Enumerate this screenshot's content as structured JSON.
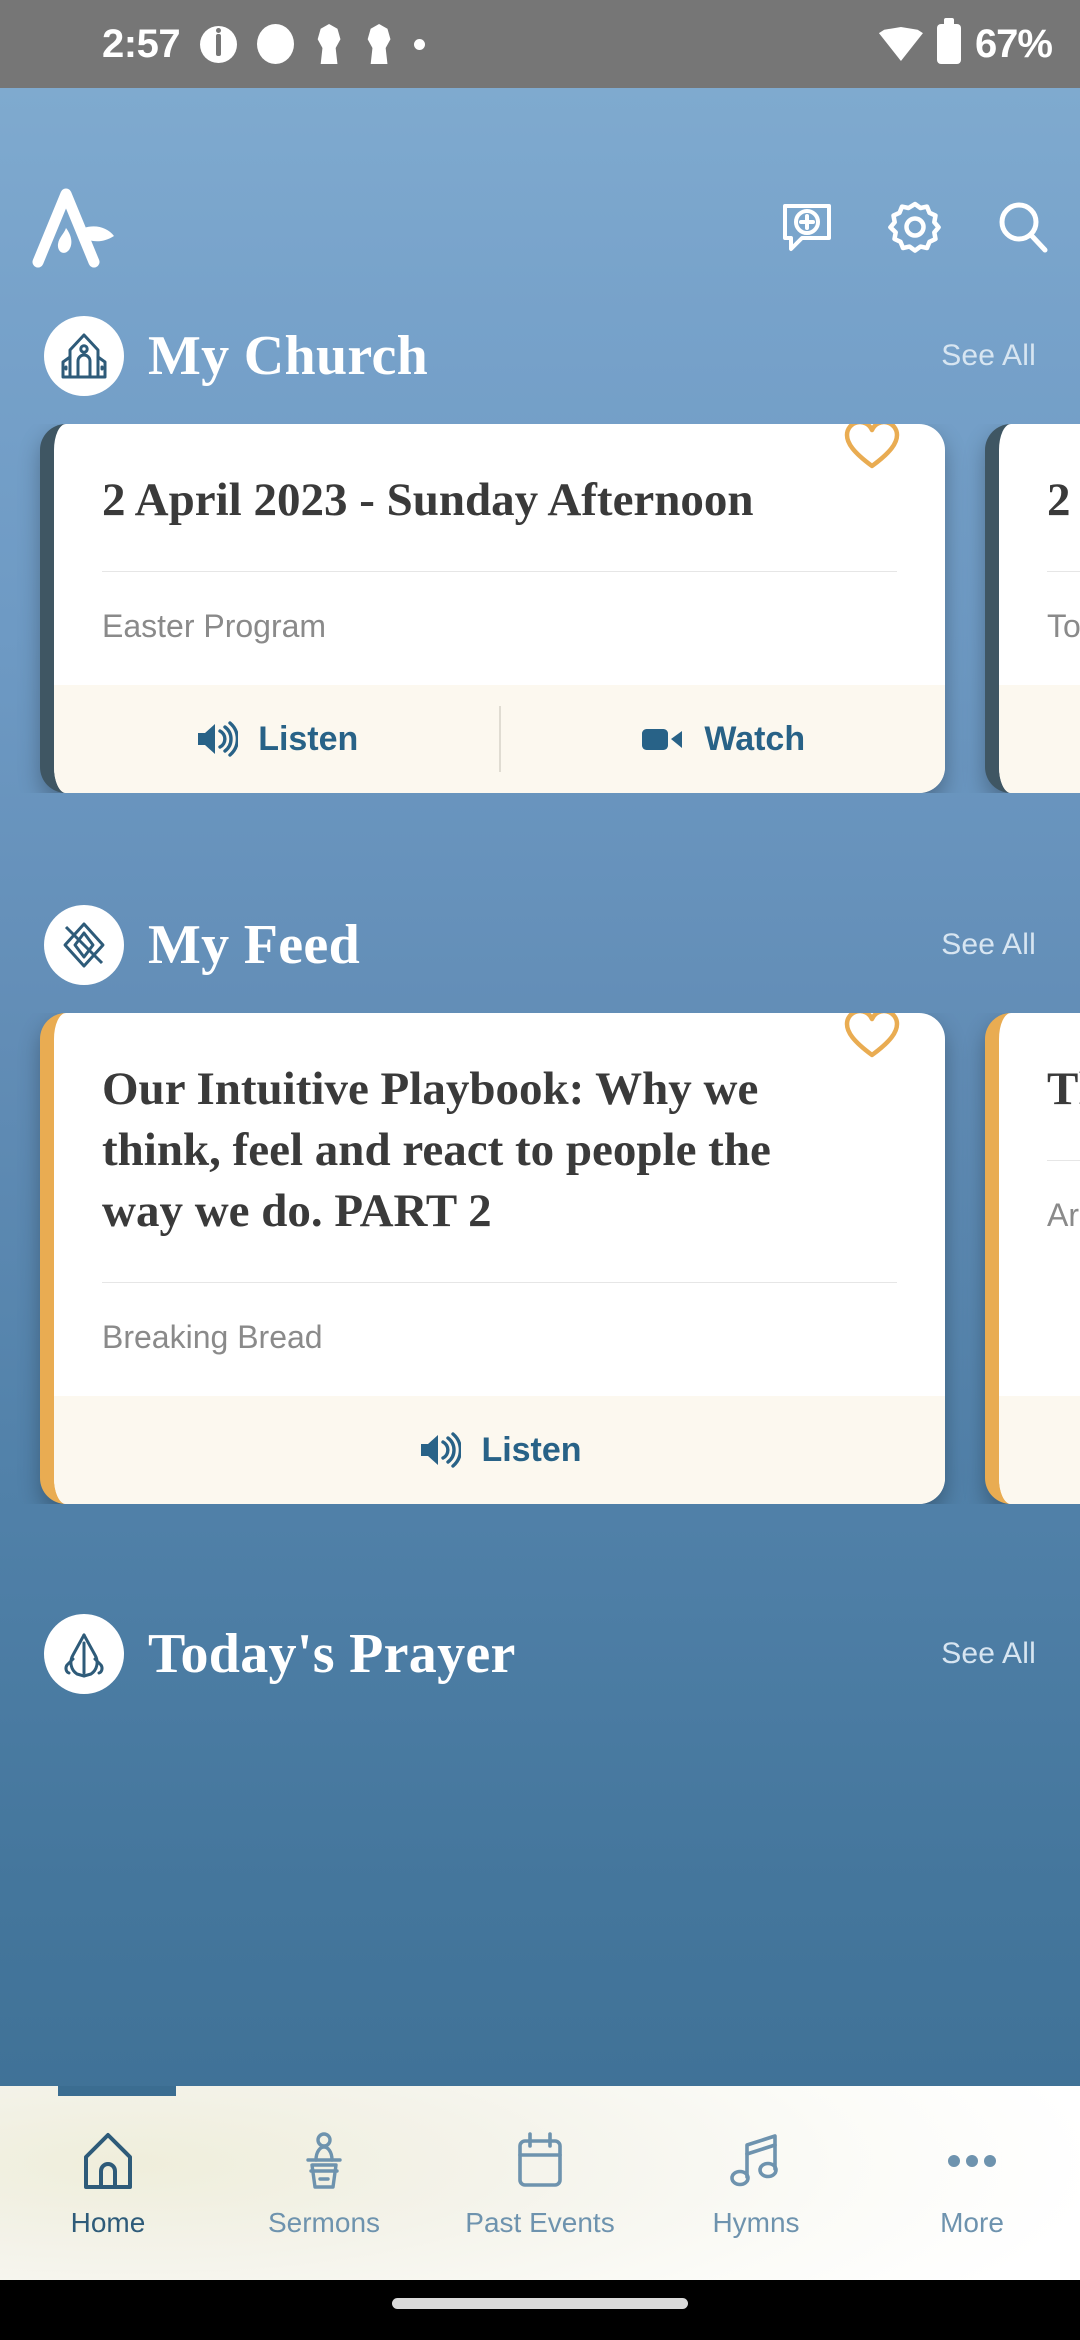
{
  "status_bar": {
    "time": "2:57",
    "battery_percent": "67%",
    "icons": [
      "info-icon",
      "circle-icon",
      "location-pin-icon",
      "location-pin-icon",
      "dot-icon"
    ],
    "right_icons": [
      "wifi-icon",
      "battery-icon"
    ],
    "background_color": "#767676"
  },
  "app_bar": {
    "logo_name": "prayer-flame-logo",
    "actions": [
      {
        "name": "add-chat-icon",
        "label": "Add Chat"
      },
      {
        "name": "gear-icon",
        "label": "Settings"
      },
      {
        "name": "search-icon",
        "label": "Search"
      }
    ],
    "background_color": "#7BA7D1"
  },
  "theme": {
    "bg_top": "#7FAACF",
    "bg_bottom": "#3B6D91",
    "accent_blue": "#286287",
    "accent_gold": "#E9AC52",
    "card_footer": "#FCF8EF"
  },
  "sections": [
    {
      "id": "my-church",
      "title": "My Church",
      "icon": "church-icon",
      "see_all": "See All",
      "cards": [
        {
          "title": "2 April 2023 - Sunday Afternoon",
          "subtitle": "Easter Program",
          "edge_color": "#3F5663",
          "favorite_icon": "heart-icon",
          "actions": [
            {
              "name": "listen-button",
              "label": "Listen",
              "icon": "speaker-icon"
            },
            {
              "name": "watch-button",
              "label": "Watch",
              "icon": "video-camera-icon"
            }
          ]
        },
        {
          "title": "2",
          "subtitle": "To",
          "edge_color": "#3F5663",
          "favorite_icon": "heart-icon",
          "actions": []
        }
      ]
    },
    {
      "id": "my-feed",
      "title": "My Feed",
      "icon": "feed-diamond-icon",
      "see_all": "See All",
      "cards": [
        {
          "title": "Our Intuitive Playbook: Why we think, feel and react to people the way we do. PART 2",
          "subtitle": "Breaking Bread",
          "edge_color": "#E9AC52",
          "favorite_icon": "heart-icon",
          "actions": [
            {
              "name": "listen-button",
              "label": "Listen",
              "icon": "speaker-icon"
            }
          ]
        },
        {
          "title": "Th",
          "subtitle": "Ar",
          "edge_color": "#E9AC52",
          "favorite_icon": "heart-icon",
          "actions": []
        }
      ]
    },
    {
      "id": "todays-prayer",
      "title": "Today's Prayer",
      "icon": "praying-hands-icon",
      "see_all": "See All",
      "cards": []
    }
  ],
  "bottom_nav": {
    "items": [
      {
        "label": "Home",
        "icon": "home-icon",
        "active": true
      },
      {
        "label": "Sermons",
        "icon": "pulpit-icon",
        "active": false
      },
      {
        "label": "Past Events",
        "icon": "calendar-icon",
        "active": false
      },
      {
        "label": "Hymns",
        "icon": "music-note-icon",
        "active": false
      },
      {
        "label": "More",
        "icon": "ellipsis-icon",
        "active": false
      }
    ]
  }
}
